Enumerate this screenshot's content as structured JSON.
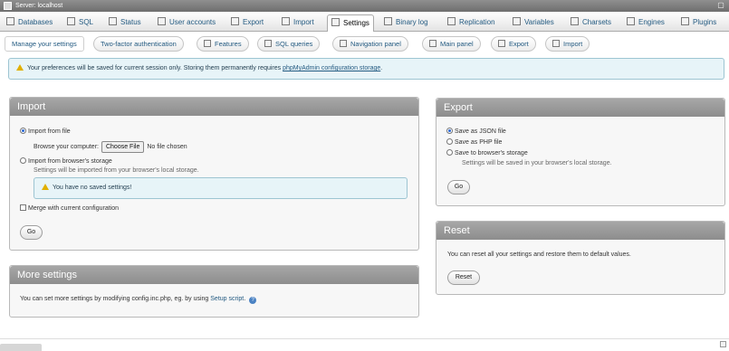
{
  "server": {
    "title": "Server: localhost"
  },
  "main_tabs": [
    {
      "label": "Databases",
      "icon": "databases-icon"
    },
    {
      "label": "SQL",
      "icon": "sql-icon"
    },
    {
      "label": "Status",
      "icon": "status-icon"
    },
    {
      "label": "User accounts",
      "icon": "user-accounts-icon"
    },
    {
      "label": "Export",
      "icon": "export-icon"
    },
    {
      "label": "Import",
      "icon": "import-icon"
    },
    {
      "label": "Settings",
      "icon": "settings-icon",
      "active": true
    },
    {
      "label": "Binary log",
      "icon": "binary-log-icon"
    },
    {
      "label": "Replication",
      "icon": "replication-icon"
    },
    {
      "label": "Variables",
      "icon": "variables-icon"
    },
    {
      "label": "Charsets",
      "icon": "charsets-icon"
    },
    {
      "label": "Engines",
      "icon": "engines-icon"
    },
    {
      "label": "Plugins",
      "icon": "plugins-icon"
    }
  ],
  "sub_tabs": [
    {
      "label": "Manage your settings",
      "active": true
    },
    {
      "label": "Two-factor authentication"
    },
    {
      "label": "Features",
      "icon": "features-icon"
    },
    {
      "label": "SQL queries",
      "icon": "sql-queries-icon"
    },
    {
      "label": "Navigation panel",
      "icon": "navigation-panel-icon"
    },
    {
      "label": "Main panel",
      "icon": "main-panel-icon"
    },
    {
      "label": "Export",
      "icon": "export-icon"
    },
    {
      "label": "Import",
      "icon": "import-icon"
    }
  ],
  "notice": {
    "text": "Your preferences will be saved for current session only. Storing them permanently requires ",
    "link": "phpMyAdmin configuration storage",
    "end": "."
  },
  "import_panel": {
    "title": "Import",
    "from_file_label": "Import from file",
    "browse_label": "Browse your computer:",
    "choose_file_label": "Choose File",
    "no_file_text": "No file chosen",
    "from_storage_label": "Import from browser's storage",
    "storage_hint": "Settings will be imported from your browser's local storage.",
    "no_saved_text": "You have no saved settings!",
    "merge_label": "Merge with current configuration",
    "go_label": "Go"
  },
  "export_panel": {
    "title": "Export",
    "json_label": "Save as JSON file",
    "php_label": "Save as PHP file",
    "storage_label": "Save to browser's storage",
    "storage_hint": "Settings will be saved in your browser's local storage.",
    "go_label": "Go"
  },
  "reset_panel": {
    "title": "Reset",
    "text": "You can reset all your settings and restore them to default values.",
    "reset_label": "Reset"
  },
  "more_panel": {
    "title": "More settings",
    "text": "You can set more settings by modifying config.inc.php, eg. by using ",
    "link": "Setup script",
    "end": "."
  }
}
